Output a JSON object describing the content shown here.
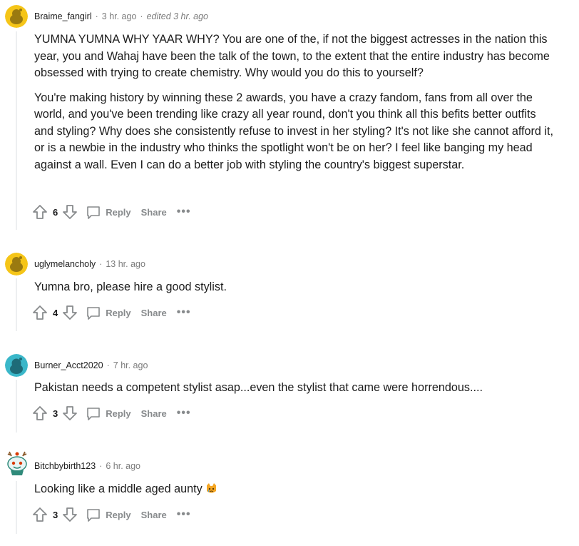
{
  "comments": [
    {
      "author": "Braime_fangirl",
      "time": "3 hr. ago",
      "edited": "edited 3 hr. ago",
      "paragraphs": [
        "YUMNA YUMNA WHY YAAR WHY? You are one of the, if not the biggest actresses in the nation this year, you and Wahaj have been the talk of the town, to the extent that the entire industry has become obsessed with trying to create chemistry. Why would you do this to yourself?",
        "You're making history by winning these 2 awards, you have a crazy fandom, fans from all over the world, and you've been trending like crazy all year round, don't you think all this befits better outfits and styling? Why does she consistently refuse to invest in her styling? It's not like she cannot afford it, or is a newbie in the industry who thinks the spotlight won't be on her? I feel like banging my head against a wall. Even I can do a better job with styling the country's biggest superstar."
      ],
      "votes": "6",
      "avatar_color": "#f5c518"
    },
    {
      "author": "uglymelancholy",
      "time": "13 hr. ago",
      "paragraphs": [
        "Yumna bro, please hire a good stylist."
      ],
      "votes": "4",
      "avatar_color": "#f5c518"
    },
    {
      "author": "Burner_Acct2020",
      "time": "7 hr. ago",
      "paragraphs": [
        "Pakistan needs a competent stylist asap...even the stylist that came were horrendous...."
      ],
      "votes": "3",
      "avatar_color": "#3ab7c9"
    },
    {
      "author": "Bitchbybirth123",
      "time": "6 hr. ago",
      "paragraphs": [
        "Looking like a middle aged aunty"
      ],
      "votes": "3",
      "emoji": "crying-cat-emoji",
      "avatar_color": "#ffffff"
    }
  ],
  "labels": {
    "reply": "Reply",
    "share": "Share",
    "more": "•••",
    "separator": "·"
  },
  "icons": {
    "upvote": "upvote-arrow-icon",
    "downvote": "downvote-arrow-icon",
    "reply": "speech-bubble-icon",
    "more": "more-options-icon"
  }
}
